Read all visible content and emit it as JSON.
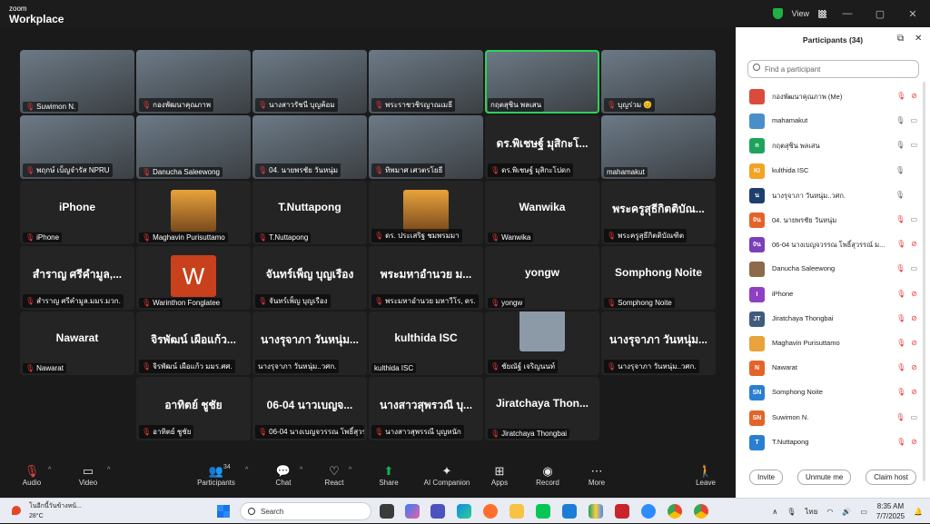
{
  "titlebar": {
    "brand_top": "zoom",
    "brand_bottom": "Workplace",
    "view_label": "View",
    "minimize": "—",
    "maximize": "▢",
    "close": "✕"
  },
  "gallery": {
    "tiles": [
      {
        "name": "Suwimon N.",
        "muted": true,
        "type": "video",
        "big": ""
      },
      {
        "name": "กองพัฒนาคุณภาพ",
        "muted": true,
        "type": "video",
        "big": ""
      },
      {
        "name": "นางสาวรัชนี บุญค้อม",
        "muted": true,
        "type": "video",
        "big": ""
      },
      {
        "name": "พระราชวชิรญาณเมธี",
        "muted": true,
        "type": "video",
        "big": ""
      },
      {
        "name": "กฤตสุชิน พลเสน",
        "muted": false,
        "type": "video",
        "big": "",
        "speaking": true
      },
      {
        "name": "บุญร่วม 😊",
        "muted": true,
        "type": "video",
        "big": ""
      },
      {
        "name": "พฤกษ์ เบ็ญจำรัส NPRU",
        "muted": true,
        "type": "video",
        "big": ""
      },
      {
        "name": "Danucha Saleewong",
        "muted": true,
        "type": "video",
        "big": ""
      },
      {
        "name": "04. นายพรชัย วันหนุ่ม",
        "muted": true,
        "type": "video",
        "big": ""
      },
      {
        "name": "ทิพมาศ เศวตรโยธี",
        "muted": true,
        "type": "video",
        "big": ""
      },
      {
        "name": "ดร.พิเชษฐ์ มุสิกะโปดก",
        "muted": true,
        "type": "name",
        "big": "ดร.พิเชษฐ์ มุสิกะโ..."
      },
      {
        "name": "mahamakut",
        "muted": false,
        "type": "video",
        "big": ""
      },
      {
        "name": "iPhone",
        "muted": true,
        "type": "name",
        "big": "iPhone"
      },
      {
        "name": "Maghavin Purisuttamo",
        "muted": true,
        "type": "avatar",
        "big": ""
      },
      {
        "name": "T.Nuttapong",
        "muted": true,
        "type": "name",
        "big": "T.Nuttapong"
      },
      {
        "name": "ดร. ประเสริฐ ชมพรมมา",
        "muted": true,
        "type": "avatar",
        "big": ""
      },
      {
        "name": "Wanwika",
        "muted": true,
        "type": "name",
        "big": "Wanwika"
      },
      {
        "name": "พระครูสุธีกิตติบัณฑิต",
        "muted": true,
        "type": "name",
        "big": "พระครูสุธีกิตติบัณ..."
      },
      {
        "name": "สำราญ ศรีคำมูล.มมร.มวก.",
        "muted": true,
        "type": "name",
        "big": "สำราญ ศรีคำมูล,..."
      },
      {
        "name": "Warinthon Fonglatee",
        "muted": true,
        "type": "w",
        "big": "W"
      },
      {
        "name": "จันทร์เพ็ญ บุญเรือง",
        "muted": true,
        "type": "name",
        "big": "จันทร์เพ็ญ บุญเรือง"
      },
      {
        "name": "พระมหาอำนวย มหาวีโร, ดร.",
        "muted": true,
        "type": "name",
        "big": "พระมหาอำนวย ม..."
      },
      {
        "name": "yongw",
        "muted": true,
        "type": "name",
        "big": "yongw"
      },
      {
        "name": "Somphong Noite",
        "muted": true,
        "type": "name",
        "big": "Somphong Noite"
      },
      {
        "name": "Nawarat",
        "muted": true,
        "type": "name",
        "big": "Nawarat"
      },
      {
        "name": "จิรพัฒน์ เผือแก้ว มมร.ศศ.",
        "muted": true,
        "type": "name",
        "big": "จิรพัฒน์ เผือแก้ว..."
      },
      {
        "name": "นางรุจาภา วันหนุ่ม..วศก.",
        "muted": false,
        "type": "name",
        "big": "นางรุจาภา วันหนุ่ม..."
      },
      {
        "name": "kulthida ISC",
        "muted": false,
        "type": "name",
        "big": "kulthida ISC"
      },
      {
        "name": "ชัยณัฐ์ เจริญนนท์",
        "muted": true,
        "type": "gray",
        "big": ""
      },
      {
        "name": "นางรุจาภา วันหนุ่ม..วศก.",
        "muted": true,
        "type": "name",
        "big": "นางรุจาภา วันหนุ่ม..."
      },
      {
        "name": "อาทิตย์ ชูชัย",
        "muted": true,
        "type": "name",
        "big": "อาทิตย์ ชูชัย"
      },
      {
        "name": "06-04 นางเบญจวรรณ โพธิ์สุวรร...",
        "muted": true,
        "type": "name",
        "big": "06-04 นาวเบญจ..."
      },
      {
        "name": "นางสาวสุพรรณี บุญหนัก",
        "muted": true,
        "type": "name",
        "big": "นางสาวสุพรวณี บุ..."
      },
      {
        "name": "Jiratchaya Thongbai",
        "muted": true,
        "type": "name",
        "big": "Jiratchaya Thon..."
      }
    ]
  },
  "toolbar": {
    "audio": "Audio",
    "video": "Video",
    "participants": "Participants",
    "participants_count": "34",
    "chat": "Chat",
    "react": "React",
    "share": "Share",
    "ai": "AI Companion",
    "apps": "Apps",
    "record": "Record",
    "more": "More",
    "leave": "Leave"
  },
  "panel": {
    "title": "Participants (34)",
    "search_placeholder": "Find a participant",
    "invite": "Invite",
    "unmute_me": "Unmute me",
    "claim_host": "Claim host",
    "participants": [
      {
        "initials": "",
        "name": "กองพัฒนาคุณภาพ (Me)",
        "color": "#d94b3b",
        "mic": "off",
        "video": "off"
      },
      {
        "initials": "",
        "name": "mahamakut",
        "color": "#4a8ec9",
        "mic": "on",
        "video": "on"
      },
      {
        "initials": "n",
        "name": "กฤตสุชิน พลเสน",
        "color": "#1fa35c",
        "mic": "on",
        "video": "on"
      },
      {
        "initials": "KI",
        "name": "kulthida ISC",
        "color": "#f2a424",
        "mic": "on",
        "video": ""
      },
      {
        "initials": "น",
        "name": "นางรุจาภา วันหนุ่ม..วศก.",
        "color": "#1e3f6e",
        "mic": "on",
        "video": ""
      },
      {
        "initials": "0น",
        "name": "04. นายพรชัย วันหนุ่ม",
        "color": "#e4632a",
        "mic": "off",
        "video": "on"
      },
      {
        "initials": "0น",
        "name": "06-04 นางเบญจวรรณ โพธิ์สุวรรณ์ ม...",
        "color": "#7b3fb8",
        "mic": "off",
        "video": "off"
      },
      {
        "initials": "",
        "name": "Danucha Saleewong",
        "color": "#8c6a4a",
        "mic": "off",
        "video": "on"
      },
      {
        "initials": "I",
        "name": "iPhone",
        "color": "#8e3fc2",
        "mic": "off",
        "video": "off"
      },
      {
        "initials": "JT",
        "name": "Jiratchaya Thongbai",
        "color": "#3f5c7d",
        "mic": "off",
        "video": "off"
      },
      {
        "initials": "",
        "name": "Maghavin Purisuttamo",
        "color": "#e8a33a",
        "mic": "off",
        "video": "off"
      },
      {
        "initials": "N",
        "name": "Nawarat",
        "color": "#e4632a",
        "mic": "off",
        "video": "off"
      },
      {
        "initials": "SN",
        "name": "Somphong Noite",
        "color": "#2a7fd1",
        "mic": "off",
        "video": "off"
      },
      {
        "initials": "SN",
        "name": "Suwimon N.",
        "color": "#e4632a",
        "mic": "off",
        "video": "on"
      },
      {
        "initials": "T",
        "name": "T.Nuttapong",
        "color": "#2a7fd1",
        "mic": "off",
        "video": "off"
      }
    ]
  },
  "taskbar": {
    "weather_text": "โนอีกนี้วันข้างหน้...",
    "temperature": "28°C",
    "search": "Search",
    "language": "ไทย",
    "time": "8:35 AM",
    "date": "7/7/2025"
  }
}
